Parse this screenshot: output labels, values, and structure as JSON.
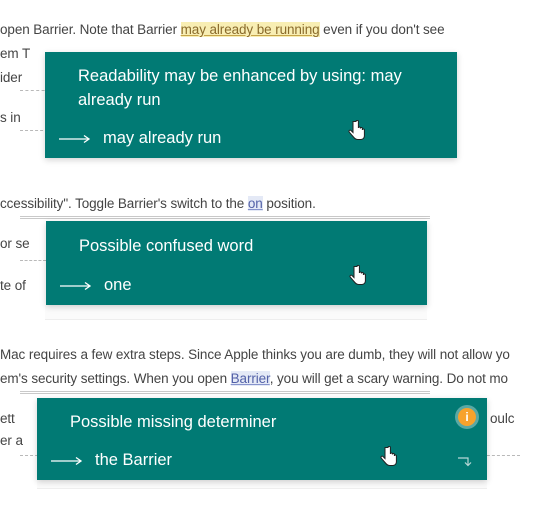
{
  "text": {
    "l1_pre": "open Barrier. Note that Barrier ",
    "l1_hl": "may already be running",
    "l1_post": " even if you don't see",
    "l2": "em T",
    "l3": "ider",
    "l4": "s in",
    "l5_pre": "ccessibility\". Toggle Barrier's switch to the ",
    "l5_hl": "on",
    "l5_post": " position.",
    "l6": "or se",
    "l7": "te of",
    "l8": "Mac requires a few extra steps. Since Apple thinks you are dumb, they will not allow yo",
    "l9_pre": "em's security settings. When you open ",
    "l9_hl": "Barrier",
    "l9_post": ", you will get a scary warning. Do not mo",
    "l10": "ett",
    "l10_end": "oulc",
    "l11": "er a"
  },
  "popup1": {
    "title": "Readability may be enhanced by using: may already run",
    "suggestion": "may already run"
  },
  "popup2": {
    "title": "Possible confused word",
    "suggestion": "one"
  },
  "popup3": {
    "title": "Possible missing determiner",
    "suggestion": "the Barrier",
    "info": "i"
  },
  "colors": {
    "popup_bg": "#017a74",
    "highlight_yellow": "#f8eeb3",
    "highlight_blue": "#e4e9f6",
    "info_badge": "#f7a22c"
  }
}
